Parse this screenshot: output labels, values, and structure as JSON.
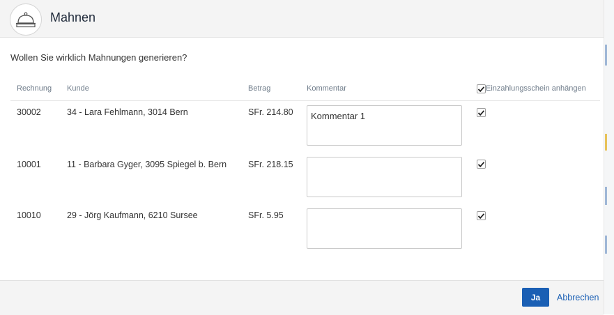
{
  "dialog": {
    "title": "Mahnen",
    "question": "Wollen Sie wirklich Mahnungen generieren?"
  },
  "columns": {
    "rechnung": "Rechnung",
    "kunde": "Kunde",
    "betrag": "Betrag",
    "kommentar": "Kommentar",
    "einzahlung": "Einzahlungsschein anhängen"
  },
  "header_checkbox_checked": true,
  "rows": [
    {
      "rechnung": "30002",
      "kunde": "34 - Lara Fehlmann, 3014 Bern",
      "betrag": "SFr. 214.80",
      "kommentar": "Kommentar 1",
      "attach": true
    },
    {
      "rechnung": "10001",
      "kunde": "11 - Barbara Gyger, 3095 Spiegel b. Bern",
      "betrag": "SFr. 218.15",
      "kommentar": "",
      "attach": true
    },
    {
      "rechnung": "10010",
      "kunde": "29 - Jörg Kaufmann, 6210 Sursee",
      "betrag": "SFr. 5.95",
      "kommentar": "",
      "attach": true
    }
  ],
  "buttons": {
    "confirm": "Ja",
    "cancel": "Abbrechen"
  },
  "icons": {
    "logo": "service-bell-icon",
    "check": "checkmark-icon"
  },
  "colors": {
    "primary": "#1a5fb4",
    "header_bg": "#f4f4f4"
  }
}
